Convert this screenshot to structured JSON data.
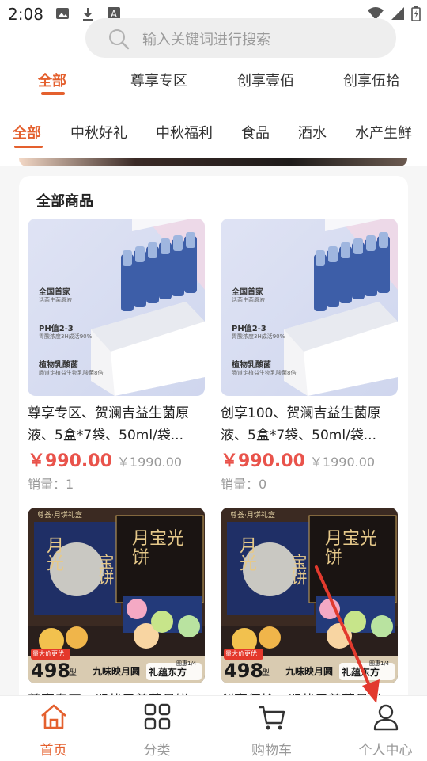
{
  "status_bar": {
    "time": "2:08",
    "icons": [
      "image-icon",
      "download-icon",
      "a-icon",
      "wifi-icon",
      "signal-icon",
      "battery-icon"
    ]
  },
  "search": {
    "placeholder": "输入关键词进行搜索"
  },
  "top_tabs": [
    {
      "label": "全部",
      "active": true
    },
    {
      "label": "尊享专区",
      "active": false
    },
    {
      "label": "创享壹佰",
      "active": false
    },
    {
      "label": "创享伍拾",
      "active": false
    }
  ],
  "category_tabs": [
    {
      "label": "全部",
      "active": true
    },
    {
      "label": "中秋好礼",
      "active": false
    },
    {
      "label": "中秋福利",
      "active": false
    },
    {
      "label": "食品",
      "active": false
    },
    {
      "label": "酒水",
      "active": false
    },
    {
      "label": "水产生鲜",
      "active": false
    }
  ],
  "section": {
    "title": "全部商品"
  },
  "products": [
    {
      "name": "尊享专区、贺澜吉益生菌原液、5盒*7袋、50ml/袋...",
      "price": "￥990.00",
      "original_price": "￥1990.00",
      "sales": "销量：1",
      "img_text": [
        "全国首家",
        "活菌生菌原液",
        "PH值2-3",
        "胃酸浓度3H成活90%",
        "植物乳酸菌",
        "肠道定植益生物乳酸菌8倍"
      ]
    },
    {
      "name": "创享100、贺澜吉益生菌原液、5盒*7袋、50ml/袋...",
      "price": "￥990.00",
      "original_price": "￥1990.00",
      "sales": "销量：0",
      "img_text": [
        "全国首家",
        "活菌生菌原液",
        "PH值2-3",
        "胃酸浓度3H成活90%",
        "植物乳酸菌",
        "肠道定植益生物乳酸菌8倍"
      ]
    },
    {
      "name": "尊享专区、聚状元美萃月饼...",
      "img_text": [
        "尊荟·月饼礼盒",
        "月光",
        "宝饼",
        "月宝光饼",
        "量大价更优",
        "498",
        "型",
        "九味映月圆",
        "礼蕴东方",
        "图惠1/4"
      ]
    },
    {
      "name": "创享伍拾、聚状元美萃月饼...",
      "img_text": [
        "尊荟·月饼礼盒",
        "月光",
        "宝饼",
        "月宝光饼",
        "量大价更优",
        "498",
        "型",
        "九味映月圆",
        "礼蕴东方",
        "图惠1/4"
      ]
    }
  ],
  "bottom_nav": [
    {
      "label": "首页",
      "icon": "home-icon",
      "active": true
    },
    {
      "label": "分类",
      "icon": "grid-icon",
      "active": false
    },
    {
      "label": "购物车",
      "icon": "cart-icon",
      "active": false
    },
    {
      "label": "个人中心",
      "icon": "user-icon",
      "active": false
    }
  ],
  "colors": {
    "accent": "#e4602e",
    "price": "#e9534b",
    "annotation_arrow": "#e23a2e"
  }
}
